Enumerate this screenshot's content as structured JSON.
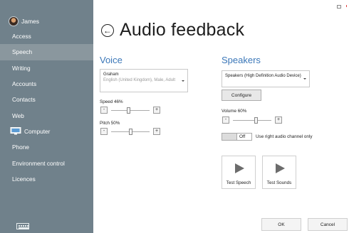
{
  "sidebar": {
    "user_name": "James",
    "items": [
      {
        "label": "Access",
        "active": false
      },
      {
        "label": "Speech",
        "active": true
      },
      {
        "label": "Writing",
        "active": false
      },
      {
        "label": "Accounts",
        "active": false
      },
      {
        "label": "Contacts",
        "active": false
      },
      {
        "label": "Web",
        "active": false
      },
      {
        "label": "Computer",
        "active": false,
        "icon": "monitor-icon"
      },
      {
        "label": "Phone",
        "active": false
      },
      {
        "label": "Environment control",
        "active": false
      },
      {
        "label": "Licences",
        "active": false
      }
    ],
    "keyboard_icon": "keyboard-icon",
    "bg_color": "#70818b",
    "active_color": "#8a979e"
  },
  "page": {
    "title": "Audio feedback",
    "back_icon": "back-arrow-icon"
  },
  "voice": {
    "section_title": "Voice",
    "voice_name": "Graham",
    "voice_detail": "English (United Kingdom), Male, Adult",
    "speed_label": "Speed 46%",
    "speed_value": 46,
    "pitch_label": "Pitch 50%",
    "pitch_value": 50
  },
  "speakers": {
    "section_title": "Speakers",
    "device": "Speakers (High Definition Audio Device)",
    "configure_label": "Configure",
    "volume_label": "Volume 60%",
    "volume_value": 60,
    "toggle_state": "Off",
    "toggle_caption": "Use right audio channel only",
    "test_speech_label": "Test Speech",
    "test_sounds_label": "Test Sounds"
  },
  "footer": {
    "ok_label": "OK",
    "cancel_label": "Cancel"
  },
  "stepper": {
    "minus": "-",
    "plus": "+"
  },
  "accent_color": "#3b77b8"
}
